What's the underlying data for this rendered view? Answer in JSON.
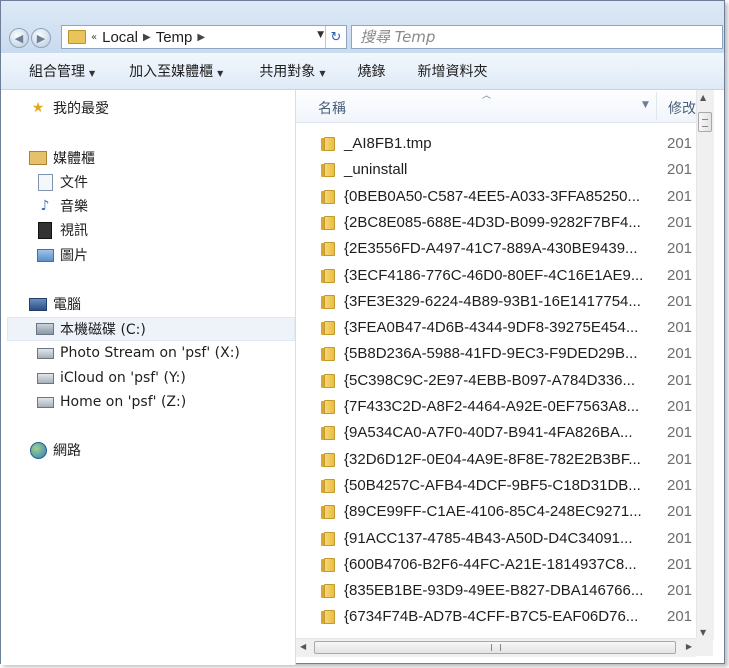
{
  "address": {
    "segments": [
      "Local",
      "Temp"
    ],
    "overflow": "«"
  },
  "search": {
    "placeholder": "搜尋 Temp"
  },
  "toolbar": {
    "organize": "組合管理",
    "add_to_library": "加入至媒體櫃",
    "share_with": "共用對象",
    "burn": "燒錄",
    "new_folder": "新增資料夾"
  },
  "nav": {
    "favorites": "我的最愛",
    "libraries": "媒體櫃",
    "documents": "文件",
    "music": "音樂",
    "videos": "視訊",
    "pictures": "圖片",
    "computer": "電腦",
    "local_disk": "本機磁碟 (C:)",
    "drive_x": "Photo Stream on 'psf' (X:)",
    "drive_y": "iCloud on 'psf' (Y:)",
    "drive_z": "Home on 'psf' (Z:)",
    "network": "網路"
  },
  "columns": {
    "name": "名稱",
    "modified": "修改"
  },
  "files": [
    {
      "name": "_AI8FB1.tmp",
      "date": "201"
    },
    {
      "name": "_uninstall",
      "date": "201"
    },
    {
      "name": "{0BEB0A50-C587-4EE5-A033-3FFA85250...",
      "date": "201"
    },
    {
      "name": "{2BC8E085-688E-4D3D-B099-9282F7BF4...",
      "date": "201"
    },
    {
      "name": "{2E3556FD-A497-41C7-889A-430BE9439...",
      "date": "201"
    },
    {
      "name": "{3ECF4186-776C-46D0-80EF-4C16E1AE9...",
      "date": "201"
    },
    {
      "name": "{3FE3E329-6224-4B89-93B1-16E1417754...",
      "date": "201"
    },
    {
      "name": "{3FEA0B47-4D6B-4344-9DF8-39275E454...",
      "date": "201"
    },
    {
      "name": "{5B8D236A-5988-41FD-9EC3-F9DED29B...",
      "date": "201"
    },
    {
      "name": "{5C398C9C-2E97-4EBB-B097-A784D336...",
      "date": "201"
    },
    {
      "name": "{7F433C2D-A8F2-4464-A92E-0EF7563A8...",
      "date": "201"
    },
    {
      "name": "{9A534CA0-A7F0-40D7-B941-4FA826BA...",
      "date": "201"
    },
    {
      "name": "{32D6D12F-0E04-4A9E-8F8E-782E2B3BF...",
      "date": "201"
    },
    {
      "name": "{50B4257C-AFB4-4DCF-9BF5-C18D31DB...",
      "date": "201"
    },
    {
      "name": "{89CE99FF-C1AE-4106-85C4-248EC9271...",
      "date": "201"
    },
    {
      "name": "{91ACC137-4785-4B43-A50D-D4C34091...",
      "date": "201"
    },
    {
      "name": "{600B4706-B2F6-44FC-A21E-1814937C8...",
      "date": "201"
    },
    {
      "name": "{835EB1BE-93D9-49EE-B827-DBA146766...",
      "date": "201"
    },
    {
      "name": "{6734F74B-AD7B-4CFF-B7C5-EAF06D76...",
      "date": "201"
    }
  ],
  "colors": {
    "toolbar_bg": "#dfeaf7",
    "folder_yellow": "#f7d774",
    "selected_bg": "#eef3fa"
  }
}
